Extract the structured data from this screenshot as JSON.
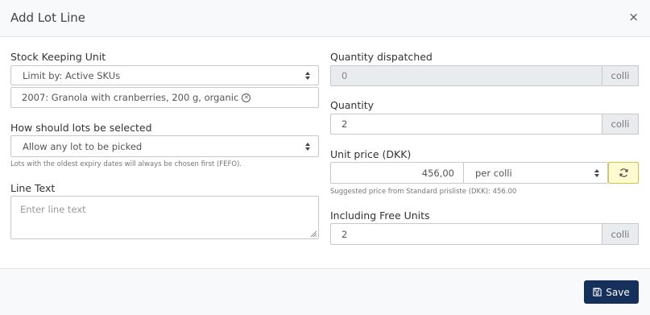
{
  "dialog": {
    "title": "Add Lot Line",
    "close_symbol": "×"
  },
  "sku": {
    "label": "Stock Keeping Unit",
    "filter_value": "Limit by: Active SKUs",
    "selected_value": "2007: Granola with cranberries, 200 g, organic",
    "clear_symbol": "⊗"
  },
  "lot_selection": {
    "label": "How should lots be selected",
    "value": "Allow any lot to be picked",
    "hint": "Lots with the oldest expiry dates will always be chosen first (FEFO)."
  },
  "line_text": {
    "label": "Line Text",
    "placeholder": "Enter line text"
  },
  "quantity_dispatched": {
    "label": "Quantity dispatched",
    "value": "0",
    "unit": "colli"
  },
  "quantity": {
    "label": "Quantity",
    "value": "2",
    "unit": "colli"
  },
  "unit_price": {
    "label": "Unit price (DKK)",
    "value": "456,00",
    "per_value": "per colli",
    "hint": "Suggested price from Standard prisliste (DKK): 456.00"
  },
  "free_units": {
    "label": "Including Free Units",
    "value": "2",
    "unit": "colli"
  },
  "footer": {
    "save_label": "Save"
  },
  "colors": {
    "save_button": "#15305b",
    "refresh_button_bg": "#fffbd0",
    "header_bg": "#f8f9fa"
  }
}
